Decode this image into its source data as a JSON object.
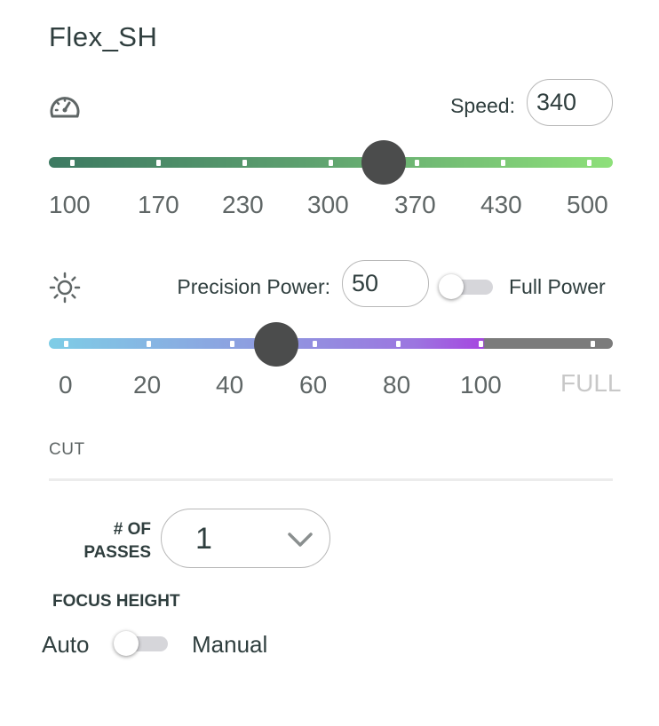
{
  "title": "Flex_SH",
  "icons": {
    "speed": "gauge-icon",
    "power": "sun-icon",
    "dropdown": "chevron-down-icon"
  },
  "speed": {
    "label": "Speed:",
    "value": "340",
    "min": 100,
    "max": 500,
    "ticks": [
      "100",
      "170",
      "230",
      "300",
      "370",
      "430",
      "500"
    ],
    "colors": {
      "start": "#3d7a62",
      "end": "#8ee07a"
    }
  },
  "power": {
    "label": "Precision Power:",
    "value": "50",
    "full_power_label": "Full Power",
    "full_power_on": false,
    "ticks": [
      "0",
      "20",
      "40",
      "60",
      "80",
      "100",
      "FULL"
    ],
    "colors": {
      "start": "#7ecde6",
      "end": "#a646e0",
      "full": "#7b7b7b"
    }
  },
  "cut": {
    "section_label": "CUT",
    "passes_label_line1": "# OF",
    "passes_label_line2": "PASSES",
    "passes_value": "1"
  },
  "focus": {
    "label": "FOCUS HEIGHT",
    "auto_label": "Auto",
    "manual_label": "Manual",
    "manual_on": false
  }
}
